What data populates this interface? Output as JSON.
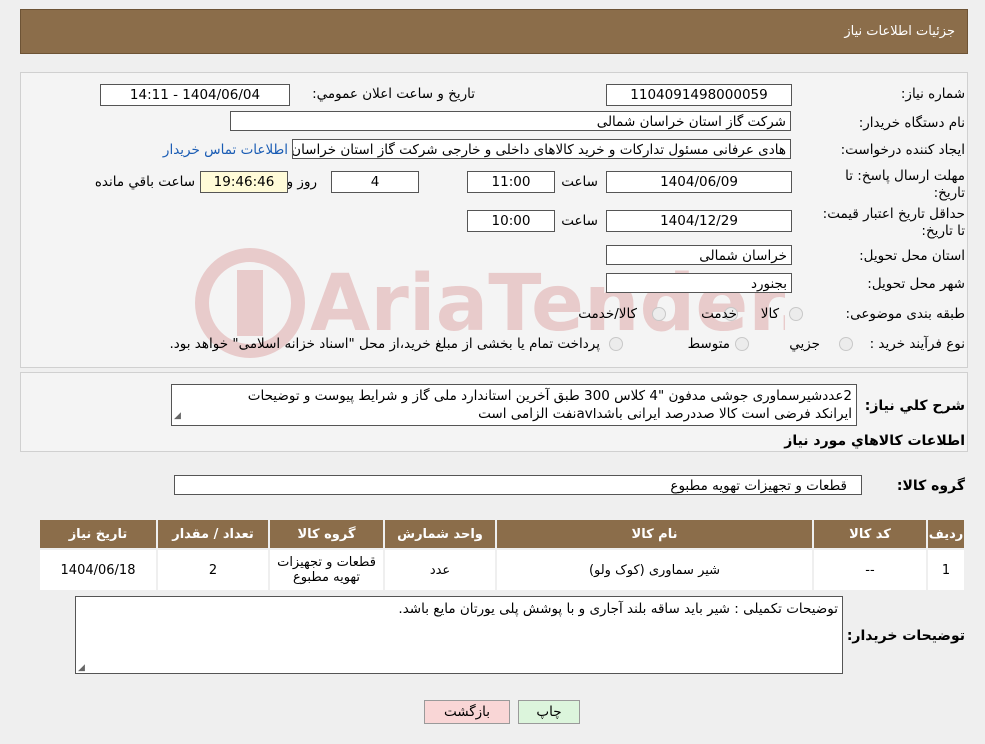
{
  "header": {
    "title": "جزئیات اطلاعات نیاز"
  },
  "form": {
    "need_no_label": "شماره نیاز:",
    "need_no": "1104091498000059",
    "announce_label": "تاریخ و ساعت اعلان عمومي:",
    "announce_value": "1404/06/04 - 14:11",
    "buyer_label": "نام دستگاه خریدار:",
    "buyer": "شرکت گاز استان خراسان شمالی",
    "creator_label": "ایجاد کننده درخواست:",
    "creator": "هادی عرفانی مسئول تدارکات و خرید کالاهای داخلی و خارجی شرکت گاز استان خراسان",
    "contact_link": "اطلاعات تماس خریدار",
    "deadline_label": "مهلت ارسال پاسخ: تا تاریخ:",
    "deadline_date": "1404/06/09",
    "time_label": "ساعت",
    "deadline_time": "11:00",
    "days": "4",
    "days_label": "روز و",
    "remaining": "19:46:46",
    "remaining_label": "ساعت باقي مانده",
    "validity_label": "حداقل تاریخ اعتبار قیمت: تا تاریخ:",
    "validity_date": "1404/12/29",
    "validity_time": "10:00",
    "province_label": "استان محل تحویل:",
    "province": "خراسان شمالی",
    "city_label": "شهر محل تحویل:",
    "city": "بجنورد",
    "category_label": "طبقه بندی موضوعی:",
    "cat_options": [
      "کالا",
      "خدمت",
      "کالا/خدمت"
    ],
    "process_label": "نوع فرآیند خرید :",
    "process_options": [
      "جزيي",
      "متوسط"
    ],
    "process_note": "پرداخت تمام یا بخشی از مبلغ خرید،از محل \"اسناد خزانه اسلامی\" خواهد بود."
  },
  "summary": {
    "label": "شرح کلي نياز:",
    "line1": "2عددشیرسماوری جوشی مدفون \"4 کلاس 300  طبق آخرین استاندارد ملی گاز و شرایط پیوست و توضیحات",
    "line2": "ایرانکد فرضی است کالا صددرصد ایرانی باشدavlنفت الزامی است"
  },
  "goods": {
    "title": "اطلاعات کالاهاي مورد نياز",
    "group_label": "گروه کالا:",
    "group_value": "قطعات و تجهیزات تهویه مطبوع",
    "headers": [
      "ردیف",
      "کد کالا",
      "نام کالا",
      "واحد شمارش",
      "گروه کالا",
      "تعداد / مقدار",
      "تاریخ نیاز"
    ],
    "rows": [
      {
        "idx": "1",
        "code": "--",
        "name": "شیر سماوری (کوک ولو)",
        "unit": "عدد",
        "group": "قطعات و تجهیزات تهویه مطبوع",
        "qty": "2",
        "date": "1404/06/18"
      }
    ]
  },
  "buyer_notes": {
    "label": "توضیحات خریدار:",
    "text": "توضیحات تکمیلی : شیر باید ساقه بلند آجاری و با  پوشش پلی یورتان مایع باشد."
  },
  "buttons": {
    "print": "چاپ",
    "back": "بازگشت"
  },
  "colors": {
    "header_bg": "#8b6d4a",
    "back_button": "#f9d6d6",
    "print_button": "#dcf5dc",
    "link": "#1a5cb4"
  }
}
